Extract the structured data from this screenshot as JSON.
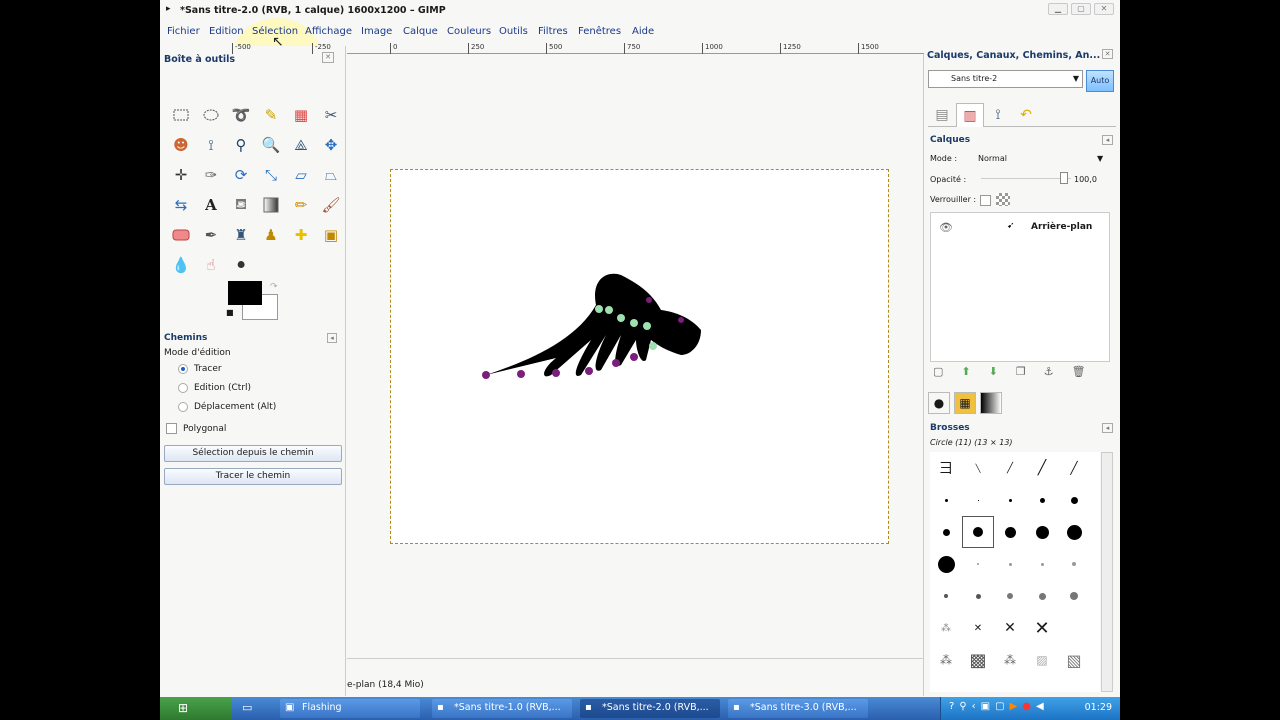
{
  "window": {
    "title": "*Sans titre-2.0 (RVB, 1 calque) 1600x1200 – GIMP",
    "app_icon": "wilber-icon"
  },
  "menubar": [
    "Fichier",
    "Edition",
    "Sélection",
    "Affichage",
    "Image",
    "Calque",
    "Couleurs",
    "Outils",
    "Filtres",
    "Fenêtres",
    "Aide"
  ],
  "toolbox": {
    "title": "Boîte à outils",
    "tools": [
      "rect-select-icon",
      "ellipse-select-icon",
      "free-select-icon",
      "fuzzy-select-icon",
      "color-select-icon",
      "scissors-icon",
      "foreground-select-icon",
      "paths-icon",
      "color-picker-icon",
      "zoom-icon",
      "measure-icon",
      "move-icon",
      "align-icon",
      "crop-icon",
      "rotate-icon",
      "scale-icon",
      "shear-icon",
      "perspective-icon",
      "flip-icon",
      "text-icon",
      "bucket-fill-icon",
      "blend-icon",
      "pencil-icon",
      "paintbrush-icon",
      "eraser-icon",
      "airbrush-icon",
      "ink-icon",
      "clone-icon",
      "heal-icon",
      "perspective-clone-icon",
      "blur-icon",
      "smudge-icon",
      "dodge-burn-icon"
    ],
    "paths": {
      "title": "Chemins",
      "mode_label": "Mode d'édition",
      "modes": [
        "Tracer",
        "Edition (Ctrl)",
        "Déplacement (Alt)"
      ],
      "selected_mode": "Tracer",
      "polygonal_label": "Polygonal",
      "btn_selection": "Sélection depuis le chemin",
      "btn_stroke": "Tracer le chemin"
    }
  },
  "ruler_ticks": [
    "-500",
    "-250",
    "0",
    "250",
    "500",
    "750",
    "1000",
    "1250",
    "1500"
  ],
  "status": {
    "text": "e-plan (18,4 Mio)"
  },
  "dock": {
    "title": "Calques, Canaux, Chemins, An...",
    "image_select": "Sans titre-2",
    "auto_label": "Auto",
    "layers": {
      "title": "Calques",
      "mode_label": "Mode :",
      "mode_value": "Normal",
      "opacity_label": "Opacité :",
      "opacity_value": "100,0",
      "lock_label": "Verrouiller :",
      "layer_name": "Arrière-plan"
    },
    "brushes": {
      "title": "Brosses",
      "selected": "Circle (11) (13 × 13)"
    }
  },
  "taskbar": {
    "tasks": [
      "Flashing",
      "*Sans titre-1.0 (RVB,...",
      "*Sans titre-2.0 (RVB,...",
      "*Sans titre-3.0 (RVB,..."
    ],
    "active_task": "*Sans titre-2.0 (RVB,...",
    "clock": "01:29"
  }
}
